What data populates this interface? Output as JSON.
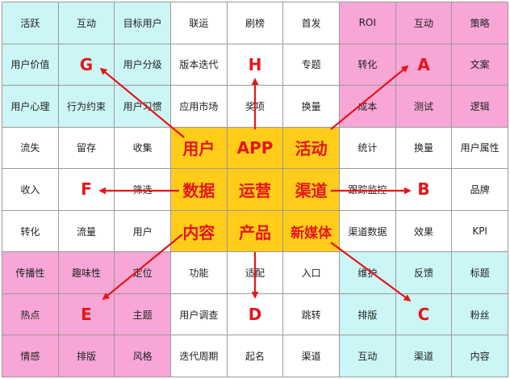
{
  "diagram": {
    "colors": {
      "cyan": "#ccf5f5",
      "pink": "#f7a6d6",
      "gold": "#ffcc1a",
      "white": "#ffffff",
      "accent": "#e4161b"
    },
    "grid": [
      [
        {
          "t": "活跃",
          "c": "cyan"
        },
        {
          "t": "互动",
          "c": "cyan"
        },
        {
          "t": "目标用户",
          "c": "cyan"
        },
        {
          "t": "联运",
          "c": "white"
        },
        {
          "t": "刷榜",
          "c": "white"
        },
        {
          "t": "首发",
          "c": "white"
        },
        {
          "t": "ROI",
          "c": "pink"
        },
        {
          "t": "互动",
          "c": "pink"
        },
        {
          "t": "策略",
          "c": "pink"
        }
      ],
      [
        {
          "t": "用户价值",
          "c": "cyan"
        },
        {
          "t": "G",
          "c": "cyan",
          "k": "letter"
        },
        {
          "t": "用户分级",
          "c": "cyan"
        },
        {
          "t": "版本迭代",
          "c": "white"
        },
        {
          "t": "H",
          "c": "white",
          "k": "letter"
        },
        {
          "t": "专题",
          "c": "white"
        },
        {
          "t": "转化",
          "c": "pink"
        },
        {
          "t": "A",
          "c": "pink",
          "k": "letter"
        },
        {
          "t": "文案",
          "c": "pink"
        }
      ],
      [
        {
          "t": "用户心理",
          "c": "cyan"
        },
        {
          "t": "行为约束",
          "c": "cyan"
        },
        {
          "t": "用户习惯",
          "c": "cyan"
        },
        {
          "t": "应用市场",
          "c": "white"
        },
        {
          "t": "奖项",
          "c": "white"
        },
        {
          "t": "换量",
          "c": "white"
        },
        {
          "t": "成本",
          "c": "pink"
        },
        {
          "t": "测试",
          "c": "pink"
        },
        {
          "t": "逻辑",
          "c": "pink"
        }
      ],
      [
        {
          "t": "流失",
          "c": "white"
        },
        {
          "t": "留存",
          "c": "white"
        },
        {
          "t": "收集",
          "c": "white"
        },
        {
          "t": "用户",
          "c": "gold",
          "k": "core"
        },
        {
          "t": "APP",
          "c": "gold",
          "k": "core"
        },
        {
          "t": "活动",
          "c": "gold",
          "k": "core"
        },
        {
          "t": "统计",
          "c": "white"
        },
        {
          "t": "换量",
          "c": "white"
        },
        {
          "t": "用户属性",
          "c": "white"
        }
      ],
      [
        {
          "t": "收入",
          "c": "white"
        },
        {
          "t": "F",
          "c": "white",
          "k": "letter"
        },
        {
          "t": "筛选",
          "c": "white"
        },
        {
          "t": "数据",
          "c": "gold",
          "k": "core"
        },
        {
          "t": "运营",
          "c": "gold",
          "k": "core"
        },
        {
          "t": "渠道",
          "c": "gold",
          "k": "core"
        },
        {
          "t": "跟踪监控",
          "c": "white"
        },
        {
          "t": "B",
          "c": "white",
          "k": "letter"
        },
        {
          "t": "品牌",
          "c": "white"
        }
      ],
      [
        {
          "t": "转化",
          "c": "white"
        },
        {
          "t": "流量",
          "c": "white"
        },
        {
          "t": "用户",
          "c": "white"
        },
        {
          "t": "内容",
          "c": "gold",
          "k": "core"
        },
        {
          "t": "产品",
          "c": "gold",
          "k": "core"
        },
        {
          "t": "新媒体",
          "c": "gold",
          "k": "core long"
        },
        {
          "t": "渠道数据",
          "c": "white"
        },
        {
          "t": "效果",
          "c": "white"
        },
        {
          "t": "KPI",
          "c": "white"
        }
      ],
      [
        {
          "t": "传播性",
          "c": "pink"
        },
        {
          "t": "趣味性",
          "c": "pink"
        },
        {
          "t": "定位",
          "c": "pink"
        },
        {
          "t": "功能",
          "c": "white"
        },
        {
          "t": "适配",
          "c": "white"
        },
        {
          "t": "入口",
          "c": "white"
        },
        {
          "t": "维护",
          "c": "cyan"
        },
        {
          "t": "反馈",
          "c": "cyan"
        },
        {
          "t": "标题",
          "c": "cyan"
        }
      ],
      [
        {
          "t": "热点",
          "c": "pink"
        },
        {
          "t": "E",
          "c": "pink",
          "k": "letter"
        },
        {
          "t": "主题",
          "c": "pink"
        },
        {
          "t": "用户调查",
          "c": "white"
        },
        {
          "t": "D",
          "c": "white",
          "k": "letter"
        },
        {
          "t": "跳转",
          "c": "white"
        },
        {
          "t": "排版",
          "c": "cyan"
        },
        {
          "t": "C",
          "c": "cyan",
          "k": "letter"
        },
        {
          "t": "粉丝",
          "c": "cyan"
        }
      ],
      [
        {
          "t": "情感",
          "c": "pink"
        },
        {
          "t": "排版",
          "c": "pink"
        },
        {
          "t": "风格",
          "c": "pink"
        },
        {
          "t": "迭代周期",
          "c": "white"
        },
        {
          "t": "起名",
          "c": "white"
        },
        {
          "t": "渠道",
          "c": "white"
        },
        {
          "t": "互动",
          "c": "cyan"
        },
        {
          "t": "渠道",
          "c": "cyan"
        },
        {
          "t": "内容",
          "c": "cyan"
        }
      ]
    ]
  }
}
